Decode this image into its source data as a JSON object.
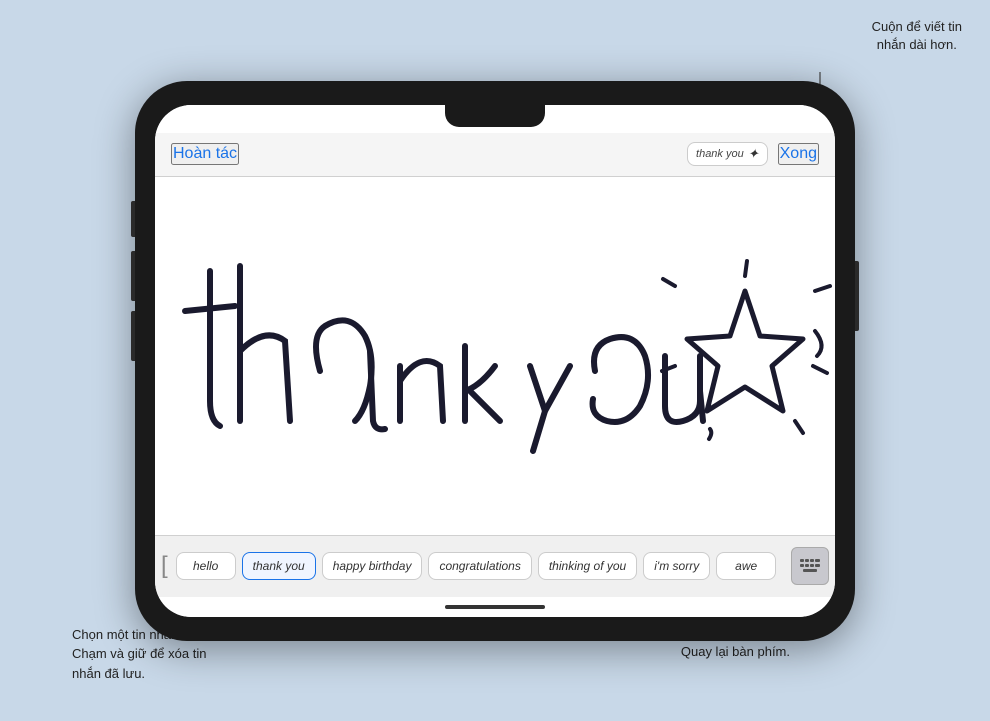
{
  "annotations": {
    "top_right": {
      "line1": "Cuộn để viết tin",
      "line2": "nhắn dài hơn."
    },
    "bottom_left": {
      "line1": "Chọn một tin nhắn đã lưu.",
      "line2": "Chạm và giữ để xóa tin",
      "line3": "nhắn đã lưu."
    },
    "bottom_right": {
      "label": "Quay lại bàn phím."
    }
  },
  "toolbar": {
    "undo_label": "Hoàn tác",
    "preview_text": "thank you",
    "done_label": "Xong"
  },
  "presets": [
    {
      "label": "hello",
      "selected": false
    },
    {
      "label": "thank you",
      "selected": true
    },
    {
      "label": "happy birthday",
      "selected": false
    },
    {
      "label": "congratulations",
      "selected": false
    },
    {
      "label": "thinking of you",
      "selected": false
    },
    {
      "label": "i'm sorry",
      "selected": false
    },
    {
      "label": "awe",
      "selected": false
    }
  ],
  "icons": {
    "chevron_right": "›",
    "keyboard": "keyboard-icon",
    "star": "✦"
  },
  "colors": {
    "blue": "#1a73e8",
    "background": "#c8d8e8",
    "phone_body": "#1a1a1a",
    "screen_bg": "#ffffff"
  }
}
